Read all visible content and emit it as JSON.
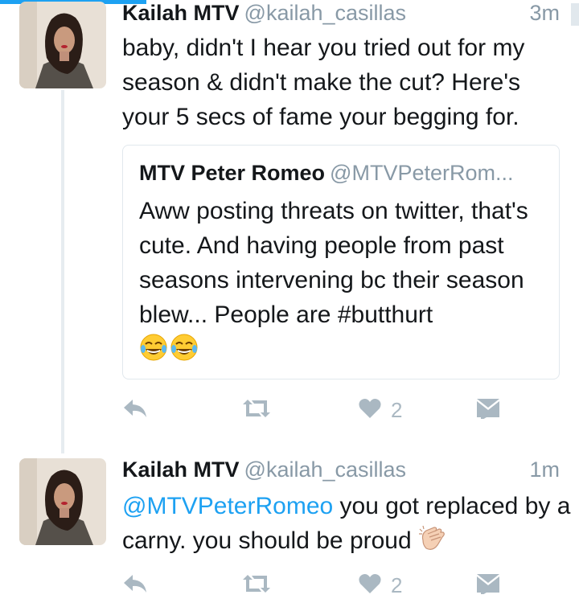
{
  "colors": {
    "link": "#1da1f2",
    "muted": "#8899a6",
    "action_icon": "#aab8c2",
    "border": "#e1e8ed"
  },
  "tweets": [
    {
      "name": "Kailah MTV",
      "handle": "@kailah_casillas",
      "time": "3m",
      "text": "baby, didn't I hear you tried out for my season & didn't make the cut? Here's your 5 secs of fame your begging for.",
      "quote": {
        "name": "MTV Peter Romeo",
        "handle": "@MTVPeterRom...",
        "text": "Aww posting threats on twitter, that's cute. And having people from past seasons intervening bc their season blew... People are #butthurt",
        "emoji": "face-with-tears-of-joy-icon x2"
      },
      "actions": {
        "like_count": "2"
      }
    },
    {
      "name": "Kailah MTV",
      "handle": "@kailah_casillas",
      "time": "1m",
      "mention": "@MTVPeterRomeo",
      "text": " you got replaced by a carny. you should be proud",
      "emoji": "clapping-hands-icon",
      "actions": {
        "like_count": "2"
      }
    }
  ]
}
